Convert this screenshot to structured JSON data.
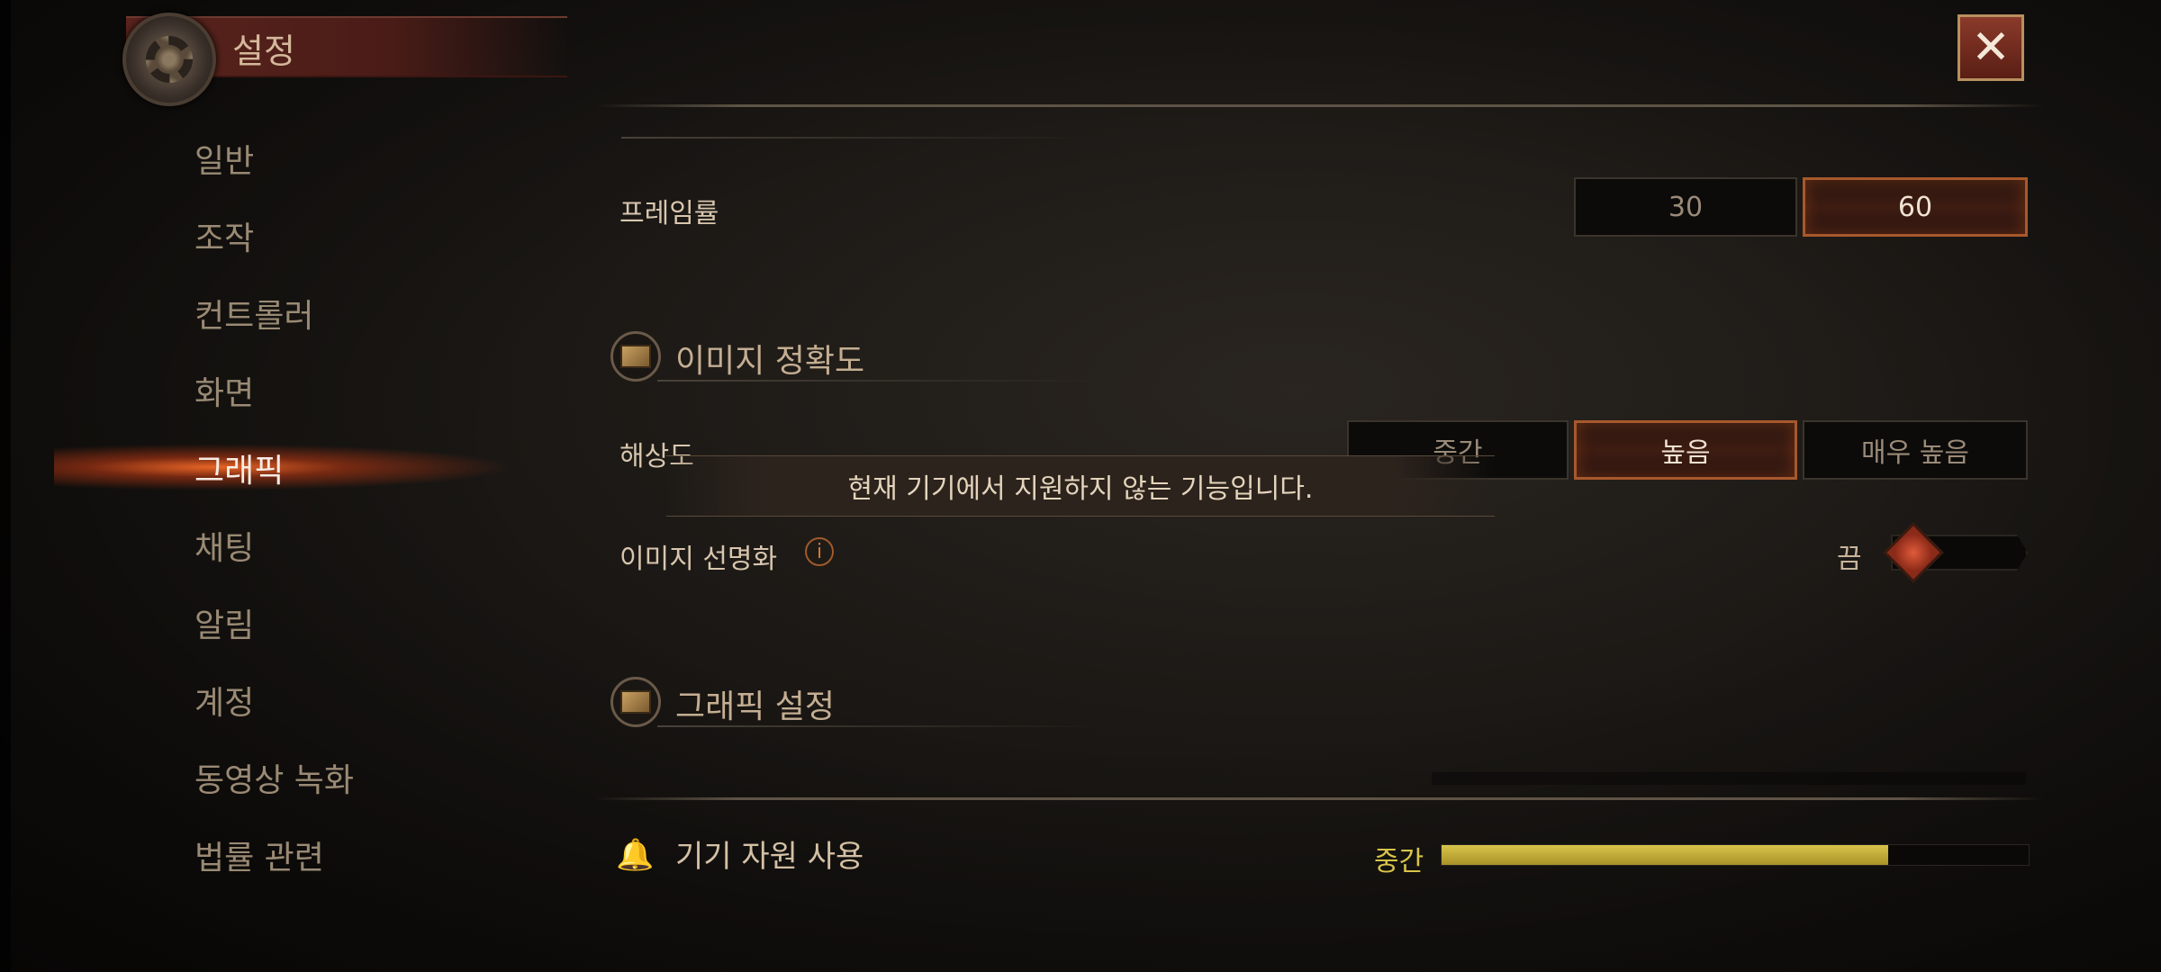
{
  "window": {
    "title": "설정",
    "close_symbol": "✕"
  },
  "sidebar": {
    "items": [
      {
        "label": "일반",
        "active": false
      },
      {
        "label": "조작",
        "active": false
      },
      {
        "label": "컨트롤러",
        "active": false
      },
      {
        "label": "화면",
        "active": false
      },
      {
        "label": "그래픽",
        "active": true
      },
      {
        "label": "채팅",
        "active": false
      },
      {
        "label": "알림",
        "active": false
      },
      {
        "label": "계정",
        "active": false
      },
      {
        "label": "동영상 녹화",
        "active": false
      },
      {
        "label": "법률 관련",
        "active": false
      }
    ]
  },
  "settings": {
    "framerate": {
      "label": "프레임률",
      "options": [
        "30",
        "60"
      ],
      "selected": "60"
    },
    "image_quality_section": {
      "title": "이미지 정확도",
      "icon": "image-icon"
    },
    "resolution": {
      "label": "해상도",
      "options": [
        "중간",
        "높음",
        "매우 높음"
      ],
      "selected": "높음"
    },
    "toast": "현재 기기에서 지원하지 않는 기능입니다.",
    "sharpening": {
      "label": "이미지 선명화",
      "info_symbol": "i",
      "state_label": "끔",
      "on": false
    },
    "graphics_section": {
      "title": "그래픽 설정",
      "icon": "image-icon"
    },
    "device_resource": {
      "label": "기기 자원 사용",
      "icon": "bell-icon",
      "level_label": "중간",
      "level_fraction": 0.76
    }
  },
  "colors": {
    "accent": "#a8582c",
    "active_glow": "#ff6e28",
    "meter": "#d8c44a"
  }
}
